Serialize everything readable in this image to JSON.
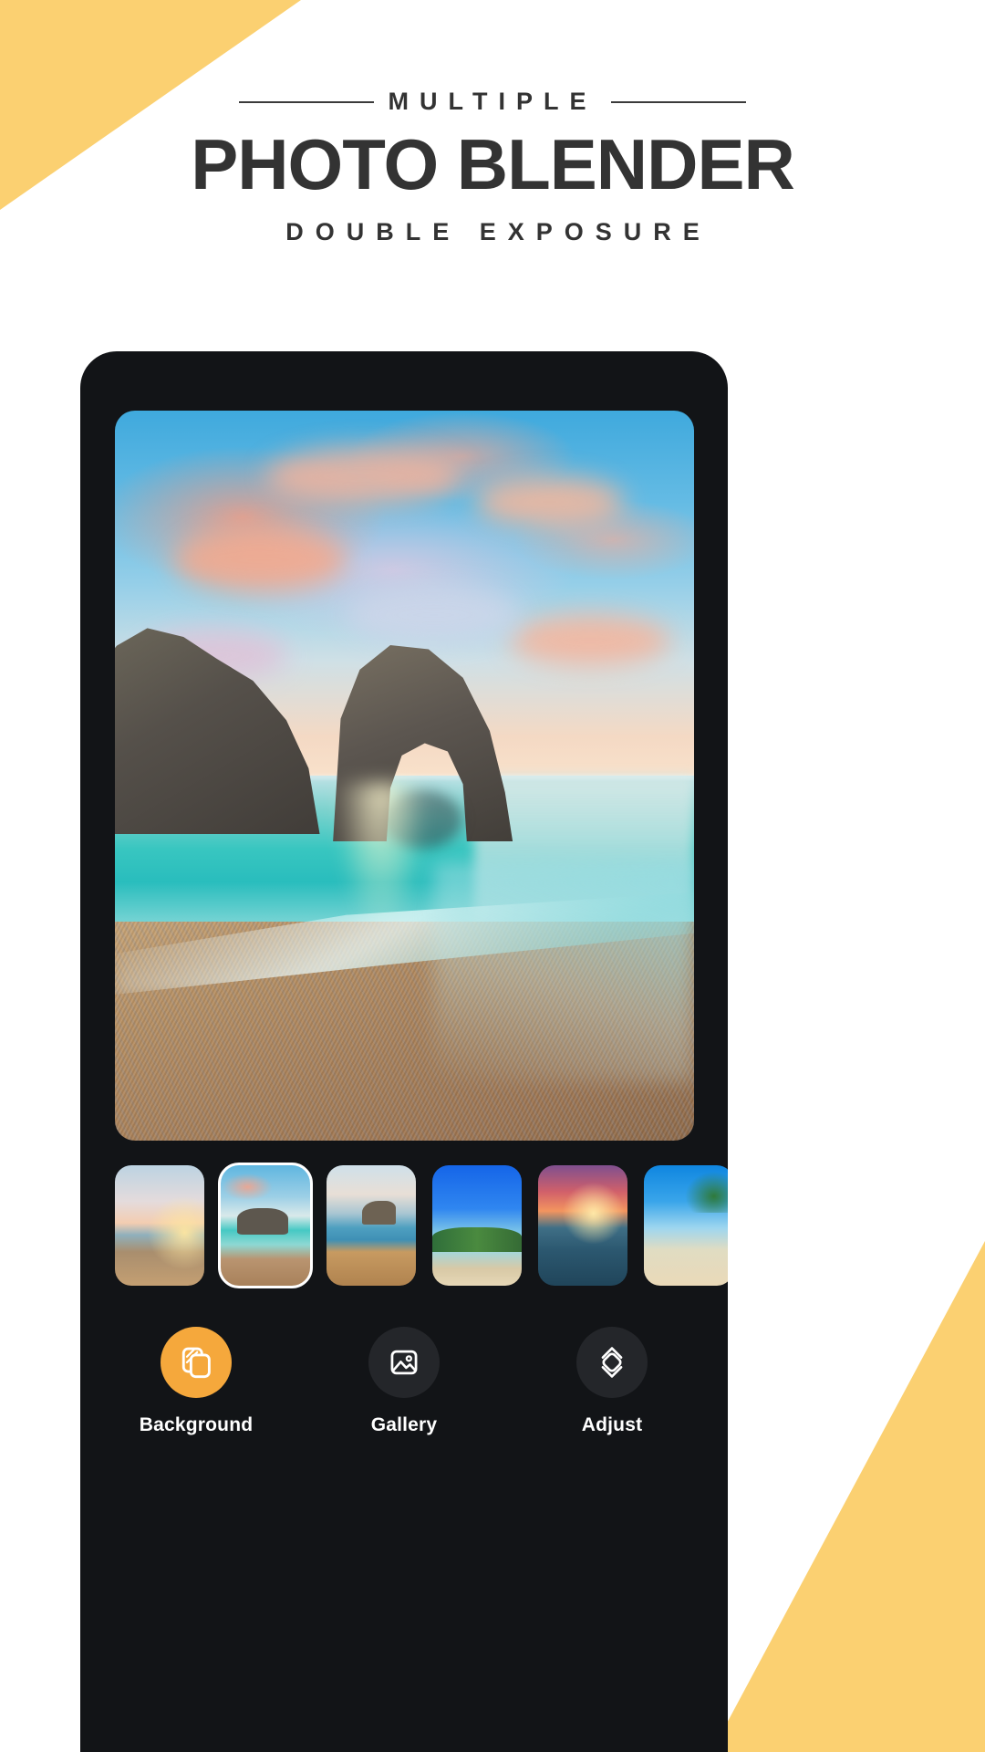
{
  "promo": {
    "kicker": "MULTIPLE",
    "title": "PHOTO BLENDER",
    "subtitle": "DOUBLE EXPOSURE"
  },
  "colors": {
    "accent_yellow": "#FBD071",
    "title_text": "#333333",
    "phone_bg": "#121417",
    "active_tool": "#F5A83C",
    "tool_circle": "#24262A"
  },
  "app": {
    "header": {
      "back_icon": "chevron-left-icon",
      "confirm_icon": "check-icon"
    },
    "canvas": {
      "label": "Durdle Door beach with rock arch at sunset"
    },
    "thumbnails": [
      {
        "id": "thumb-1",
        "label": "Sunset beach with boats",
        "art": "t-sunsetbeach",
        "selected": false
      },
      {
        "id": "thumb-2",
        "label": "Durdle Door rock arch",
        "art": "t-arch",
        "selected": true
      },
      {
        "id": "thumb-3",
        "label": "Cliff bay coastline",
        "art": "t-cliffbay",
        "selected": false
      },
      {
        "id": "thumb-4",
        "label": "Tropical longtail boat bay",
        "art": "t-tropic",
        "selected": false
      },
      {
        "id": "thumb-5",
        "label": "Red sunset over rocks",
        "art": "t-redsunset",
        "selected": false
      },
      {
        "id": "thumb-6",
        "label": "Palm beach blue sky",
        "art": "t-palmbeach",
        "selected": false
      }
    ],
    "toolbar": [
      {
        "id": "tool-background",
        "label": "Background",
        "icon": "layers-icon",
        "active": true
      },
      {
        "id": "tool-gallery",
        "label": "Gallery",
        "icon": "image-icon",
        "active": false
      },
      {
        "id": "tool-adjust",
        "label": "Adjust",
        "icon": "adjust-diamond-icon",
        "active": false
      }
    ]
  }
}
